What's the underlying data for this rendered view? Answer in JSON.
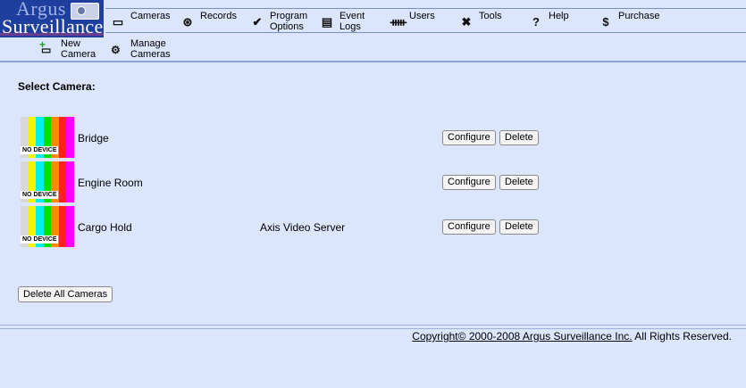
{
  "logo": {
    "line1": "Argus",
    "line2": "Surveillance"
  },
  "nav": [
    {
      "label": "Cameras",
      "icon": "camera-icon",
      "glyph": "▭"
    },
    {
      "label": "Records",
      "icon": "film-reel-icon",
      "glyph": "⊛"
    },
    {
      "label": "Program\nOptions",
      "icon": "checkmark-icon",
      "glyph": "✔"
    },
    {
      "label": "Event\nLogs",
      "icon": "document-icon",
      "glyph": "▤"
    },
    {
      "label": "Users",
      "icon": "users-icon",
      "glyph": "ᚔ"
    },
    {
      "label": "Tools",
      "icon": "tools-icon",
      "glyph": "✖"
    },
    {
      "label": "Help",
      "icon": "question-icon",
      "glyph": "?"
    },
    {
      "label": "Purchase",
      "icon": "dollar-icon",
      "glyph": "$"
    }
  ],
  "subnav": [
    {
      "label": "New\nCamera",
      "icon": "new-camera-icon"
    },
    {
      "label": "Manage\nCameras",
      "icon": "manage-cameras-icon"
    }
  ],
  "select_title": "Select Camera:",
  "thumb_text": "NO DEVICE",
  "thumb_colors": [
    "#d8d8d8",
    "#f4f400",
    "#00f0f0",
    "#00e000",
    "#ff8c00",
    "#ff2020",
    "#ff00ff"
  ],
  "cameras": [
    {
      "name": "Bridge",
      "type": ""
    },
    {
      "name": "Engine Room",
      "type": ""
    },
    {
      "name": "Cargo Hold",
      "type": "Axis Video Server"
    }
  ],
  "buttons": {
    "configure": "Configure",
    "delete": "Delete",
    "delete_all": "Delete All Cameras"
  },
  "footer": {
    "link": "Copyright© 2000-2008 Argus Surveillance Inc.",
    "rights": " All Rights Reserved."
  }
}
